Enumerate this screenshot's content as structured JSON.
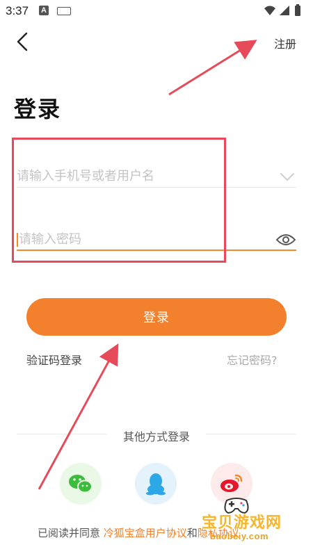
{
  "status_bar": {
    "time": "3:37",
    "notification_badge": "A"
  },
  "header": {
    "register_label": "注册"
  },
  "page": {
    "title": "登录"
  },
  "form": {
    "username_placeholder": "请输入手机号或者用户名",
    "username_value": "",
    "password_placeholder": "请输入密码",
    "password_value": "",
    "login_button_label": "登录"
  },
  "links": {
    "sms_login": "验证码登录",
    "forgot_password": "忘记密码?"
  },
  "other_login": {
    "label": "其他方式登录",
    "options": [
      "wechat-icon",
      "qq-icon",
      "weibo-icon"
    ]
  },
  "agreement": {
    "prefix": "已阅读并同意",
    "user_agreement": "冷狐宝盒用户协议",
    "connector": "和",
    "privacy": "隐私协议"
  },
  "watermark": {
    "title": "宝贝游戏网",
    "domain": "baobeiy.com"
  },
  "colors": {
    "accent": "#f3802c",
    "annotation": "#e54b5a",
    "wechat": "#3dbb3d",
    "qq": "#2da8e6",
    "weibo": "#e6162d"
  }
}
